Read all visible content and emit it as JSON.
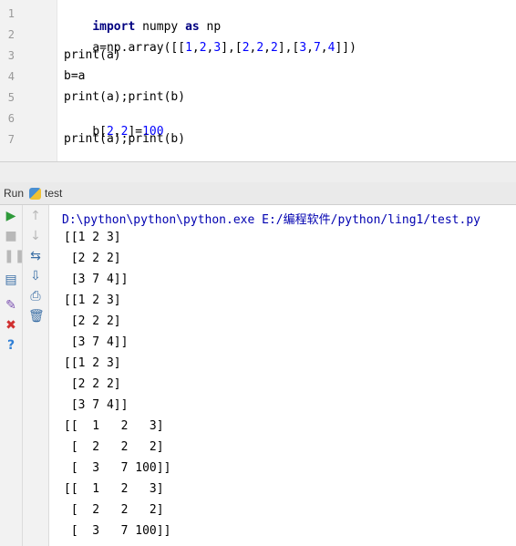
{
  "editor": {
    "line_numbers": [
      "1",
      "2",
      "3",
      "4",
      "5",
      "6",
      "7"
    ],
    "lines": [
      {
        "kw1": "import",
        "t1": " numpy ",
        "kw2": "as",
        "t2": " np"
      },
      {
        "t": "a=np.array([[",
        "n1": "1",
        "c1": ",",
        "n2": "2",
        "c2": ",",
        "n3": "3",
        "c3": "],[",
        "n4": "2",
        "c4": ",",
        "n5": "2",
        "c5": ",",
        "n6": "2",
        "c6": "],[",
        "n7": "3",
        "c7": ",",
        "n8": "7",
        "c8": ",",
        "n9": "4",
        "c9": "]])"
      },
      {
        "t": "print(a)"
      },
      {
        "t": "b=a"
      },
      {
        "t": "print(a);print(b)"
      },
      {
        "t1": "b[",
        "n1": "2",
        "c1": ",",
        "n2": "2",
        "t2": "]=",
        "n3": "100"
      },
      {
        "t": "print(a);print(b)"
      }
    ]
  },
  "runbar": {
    "label": "Run",
    "tab": "test"
  },
  "toolbar": {
    "left": [
      "run-icon",
      "stop-icon",
      "pause-icon",
      "layout-icon",
      "pin-icon",
      "close-icon",
      "help-icon"
    ],
    "right": [
      "up-arrow-icon",
      "down-arrow-icon",
      "wrap-icon",
      "scroll-end-icon",
      "print-icon",
      "trash-icon"
    ]
  },
  "console": {
    "command": "D:\\python\\python\\python.exe E:/编程软件/python/ling1/test.py",
    "output": [
      "[[1 2 3]",
      " [2 2 2]",
      " [3 7 4]]",
      "[[1 2 3]",
      " [2 2 2]",
      " [3 7 4]]",
      "[[1 2 3]",
      " [2 2 2]",
      " [3 7 4]]",
      "[[  1   2   3]",
      " [  2   2   2]",
      " [  3   7 100]]",
      "[[  1   2   3]",
      " [  2   2   2]",
      " [  3   7 100]]"
    ]
  }
}
